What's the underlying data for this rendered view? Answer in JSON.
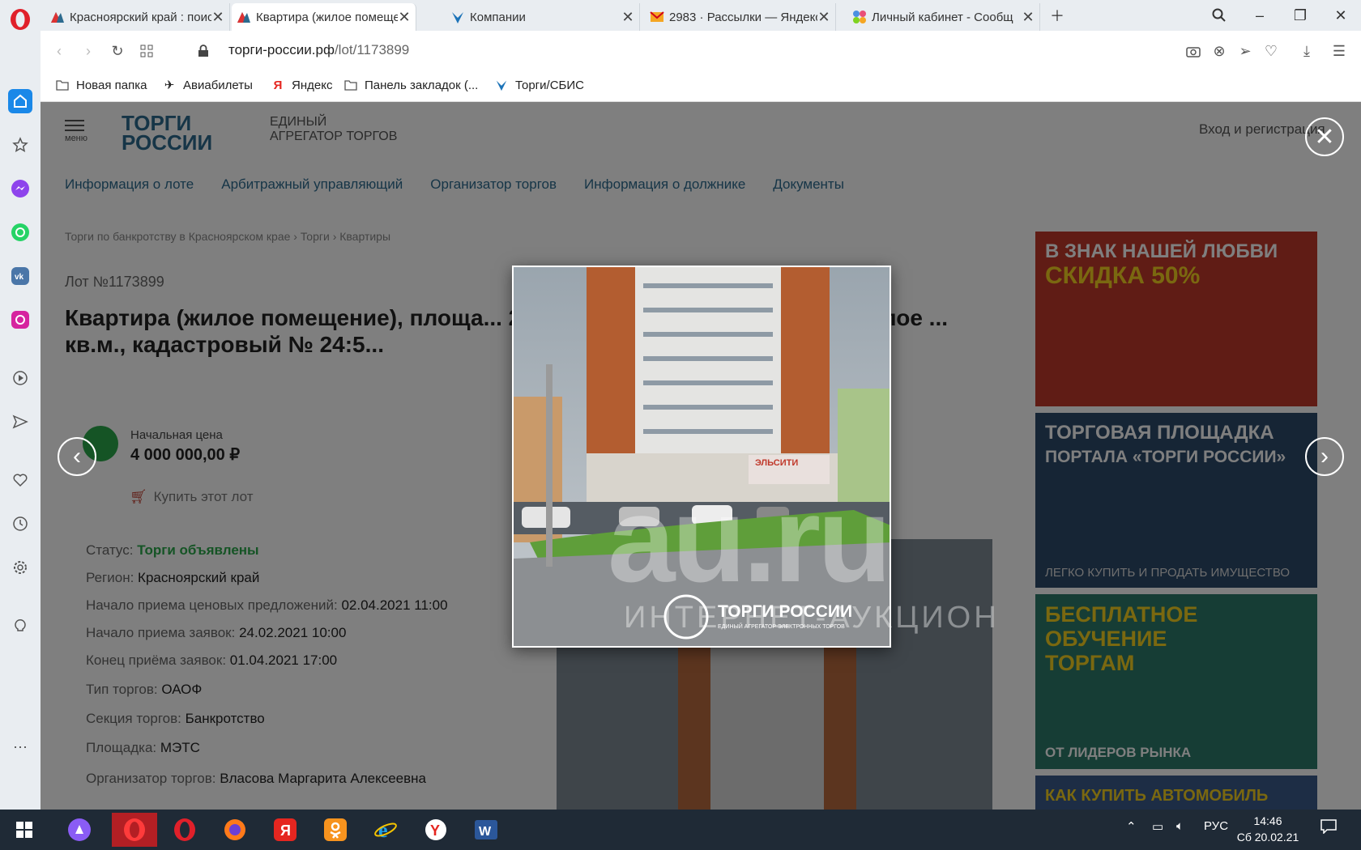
{
  "browser": {
    "tabs": [
      {
        "title": "Красноярский край : поис",
        "icon": "torgi-favicon"
      },
      {
        "title": "Квартира (жилое помеще",
        "icon": "torgi-favicon"
      },
      {
        "title": "Компании",
        "icon": "sbis-favicon"
      },
      {
        "title": "2983 · Рассылки — Яндекс",
        "icon": "mail-favicon"
      },
      {
        "title": "Личный кабинет - Сообщ",
        "icon": "multicolor-favicon"
      }
    ],
    "url_host": "торги-россии.рф",
    "url_path": "/lot/1173899",
    "bookmarks": [
      "Новая папка",
      "Авиабилеты",
      "Яндекс",
      "Панель закладок (...",
      "Торги/СБИС"
    ]
  },
  "site": {
    "menu_label": "меню",
    "logo_line1": "ТОРГИ",
    "logo_line2": "РОССИИ",
    "slogan_line1": "ЕДИНЫЙ",
    "slogan_line2": "АГРЕГАТОР ТОРГОВ",
    "login": "Вход и регистрация",
    "tabs": [
      "Информация о лоте",
      "Арбитражный управляющий",
      "Организатор торгов",
      "Информация о должнике",
      "Документы"
    ],
    "breadcrumb": "Торги по банкротству в Красноярском крае › Торги › Квартиры",
    "lot_number": "Лот №1173899",
    "title": "Квартира (жилое помещение), площа... 24:50:0300305:5792. Квартира (жилое ... кв.м., кадастровый № 24:5...",
    "price_label": "Начальная цена",
    "price": "4 000 000,00 ₽",
    "buy_label": "Купить этот лот",
    "details": [
      {
        "label": "Статус:",
        "value": "Торги объявлены"
      },
      {
        "label": "Регион:",
        "value": "Красноярский край"
      },
      {
        "label": "Начало приема ценовых предложений:",
        "value": "02.04.2021 11:00"
      },
      {
        "label": "Начало приема заявок:",
        "value": "24.02.2021 10:00"
      },
      {
        "label": "Конец приёма заявок:",
        "value": "01.04.2021 17:00"
      },
      {
        "label": "Тип торгов:",
        "value": "ОАОФ"
      },
      {
        "label": "Секция торгов:",
        "value": "Банкротство"
      },
      {
        "label": "Площадка:",
        "value": "МЭТС"
      },
      {
        "label": "Организатор торгов:",
        "value": "Власова Маргарита Алексеевна"
      }
    ],
    "ads": [
      {
        "line1": "В ЗНАК НАШЕЙ ЛЮБВИ",
        "line2": "СКИДКА 50%",
        "footer": "",
        "bg": "#c0392b",
        "color1": "#ffffff",
        "color2": "#f5d020"
      },
      {
        "line1": "ТОРГОВАЯ ПЛОЩАДКА",
        "line2": "ПОРТАЛА «ТОРГИ РОССИИ»",
        "footer": "ЛЕГКО КУПИТЬ И ПРОДАТЬ ИМУЩЕСТВО",
        "bg": "#2c4a6b",
        "color1": "#ffffff",
        "color2": "#ffffff"
      },
      {
        "line1": "БЕСПЛАТНОЕ",
        "line2": "ОБУЧЕНИЕ ТОРГАМ",
        "footer": "ОТ ЛИДЕРОВ РЫНКА",
        "bg": "#2d7a6a",
        "color1": "#f5d020",
        "color2": "#f5d020"
      },
      {
        "line1": "КАК КУПИТЬ АВТОМОБИЛЬ",
        "line2": "",
        "footer": "",
        "bg": "#3b5b8a",
        "color1": "#f5d020",
        "color2": "#f5d020"
      }
    ]
  },
  "lightbox": {
    "watermark": "au.ru",
    "watermark_sub": "ИНТЕРНЕТ-АУКЦИОН",
    "photo_logo_title": "ТОРГИ РОССИИ",
    "photo_logo_sub": "ЕДИНЫЙ АГРЕГАТОР ЭЛЕКТРОННЫХ ТОРГОВ",
    "shop_sign": "ЭЛЬСИТИ"
  },
  "taskbar": {
    "language": "РУС",
    "time": "14:46",
    "date": "Сб 20.02.21"
  },
  "colors": {
    "opera_red": "#e0202a",
    "accent_green": "#2aa84a",
    "link_blue": "#2d6b8f",
    "taskbar": "#1f2a36"
  }
}
